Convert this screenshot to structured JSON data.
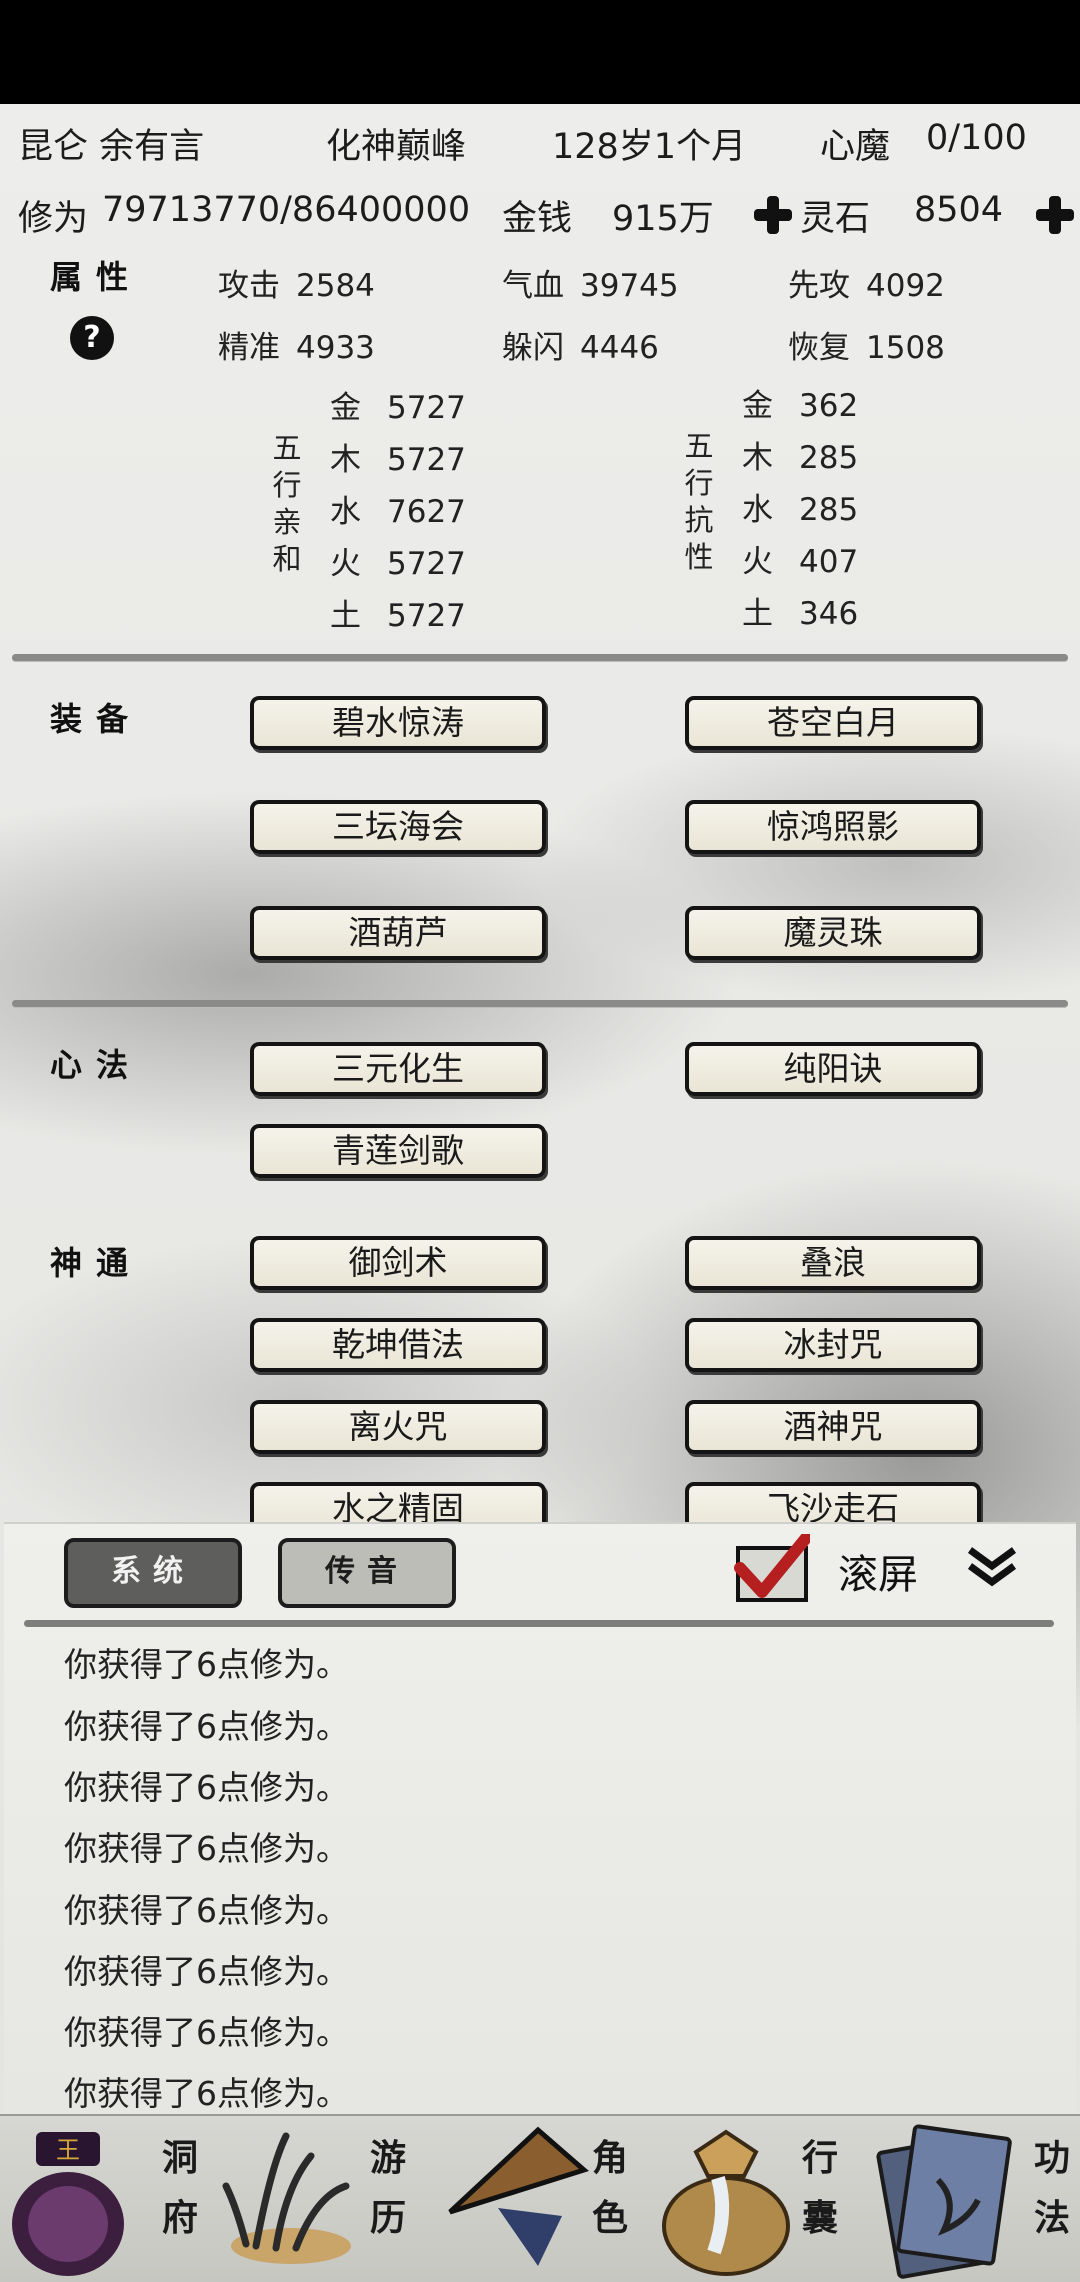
{
  "header": {
    "name": "昆仑 余有言",
    "realm": "化神巅峰",
    "age": "128岁1个月",
    "demon_label": "心魔",
    "demon_value": "0/100",
    "cultivation_label": "修为",
    "cultivation_value": "79713770/86400000",
    "money_label": "金钱",
    "money_value": "915万",
    "spirit_label": "灵石",
    "spirit_value": "8504"
  },
  "attributes": {
    "title": "属性",
    "stats": [
      {
        "label": "攻击",
        "value": "2584"
      },
      {
        "label": "气血",
        "value": "39745"
      },
      {
        "label": "先攻",
        "value": "4092"
      },
      {
        "label": "精准",
        "value": "4933"
      },
      {
        "label": "躲闪",
        "value": "4446"
      },
      {
        "label": "恢复",
        "value": "1508"
      }
    ],
    "affinity_title_chars": [
      "五",
      "行",
      "亲",
      "和"
    ],
    "resist_title_chars": [
      "五",
      "行",
      "抗",
      "性"
    ],
    "affinity": [
      {
        "element": "金",
        "value": "5727"
      },
      {
        "element": "木",
        "value": "5727"
      },
      {
        "element": "水",
        "value": "7627"
      },
      {
        "element": "火",
        "value": "5727"
      },
      {
        "element": "土",
        "value": "5727"
      }
    ],
    "resistance": [
      {
        "element": "金",
        "value": "362"
      },
      {
        "element": "木",
        "value": "285"
      },
      {
        "element": "水",
        "value": "285"
      },
      {
        "element": "火",
        "value": "407"
      },
      {
        "element": "土",
        "value": "346"
      }
    ]
  },
  "equipment": {
    "title": "装备",
    "items": [
      "碧水惊涛",
      "苍空白月",
      "三坛海会",
      "惊鸿照影",
      "酒葫芦",
      "魔灵珠"
    ]
  },
  "mind_methods": {
    "title": "心法",
    "items": [
      "三元化生",
      "纯阳诀",
      "青莲剑歌"
    ]
  },
  "divine_powers": {
    "title": "神通",
    "items": [
      "御剑术",
      "叠浪",
      "乾坤借法",
      "冰封咒",
      "离火咒",
      "酒神咒",
      "水之精固",
      "飞沙走石"
    ]
  },
  "log": {
    "tabs": [
      "系统",
      "传音"
    ],
    "scroll_label": "滚屏",
    "scroll_checked": true,
    "lines": [
      "你获得了6点修为。",
      "你获得了6点修为。",
      "你获得了6点修为。",
      "你获得了6点修为。",
      "你获得了6点修为。",
      "你获得了6点修为。",
      "你获得了6点修为。",
      "你获得了6点修为。"
    ]
  },
  "nav": [
    {
      "label_top": "洞",
      "label_bottom": "府",
      "icon": "cave-bag-icon"
    },
    {
      "label_top": "游",
      "label_bottom": "历",
      "icon": "travel-grass-icon"
    },
    {
      "label_top": "角",
      "label_bottom": "色",
      "icon": "character-hat-icon"
    },
    {
      "label_top": "行",
      "label_bottom": "囊",
      "icon": "inventory-sack-icon"
    },
    {
      "label_top": "功",
      "label_bottom": "法",
      "icon": "technique-book-icon"
    }
  ]
}
